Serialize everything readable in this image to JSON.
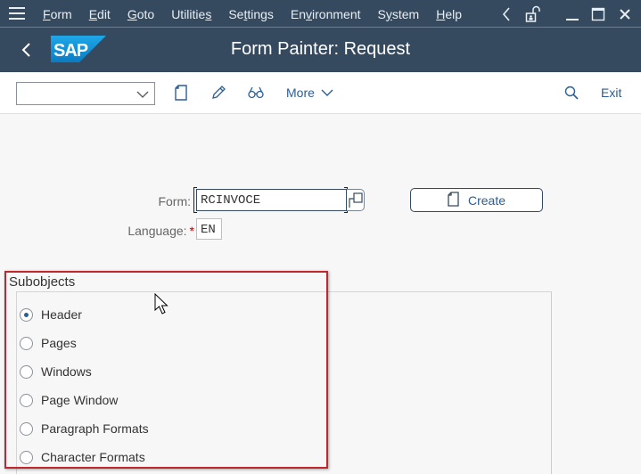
{
  "menubar": {
    "items": [
      {
        "label": "Form",
        "mnemonic": "F"
      },
      {
        "label": "Edit",
        "mnemonic": "E"
      },
      {
        "label": "Goto",
        "mnemonic": "G"
      },
      {
        "label": "Utilities",
        "mnemonic": "s"
      },
      {
        "label": "Settings",
        "mnemonic": "t"
      },
      {
        "label": "Environment",
        "mnemonic": "v"
      },
      {
        "label": "System",
        "mnemonic": "y"
      },
      {
        "label": "Help",
        "mnemonic": "H"
      }
    ],
    "icons": [
      "menu-icon",
      "back-arrow-icon",
      "unlock-icon",
      "minimize-icon",
      "maximize-icon",
      "close-icon"
    ]
  },
  "titlebar": {
    "logo": "SAP",
    "title": "Form Painter: Request"
  },
  "toolbar": {
    "select_value": "",
    "more_label": "More",
    "exit_label": "Exit",
    "icons": [
      "new-document-icon",
      "pencil-icon",
      "glasses-icon",
      "search-icon"
    ]
  },
  "form": {
    "form_label": "Form:",
    "form_value": "RCINVOCE",
    "language_label": "Language:",
    "language_required": "*",
    "language_value": "EN",
    "create_label": "Create"
  },
  "subobjects": {
    "title": "Subobjects",
    "selected": "Header",
    "options": [
      "Header",
      "Pages",
      "Windows",
      "Page Window",
      "Paragraph Formats",
      "Character Formats"
    ]
  },
  "colors": {
    "shell": "#354a5f",
    "accent": "#2a5e94",
    "highlight": "#c0282d",
    "sap_blue": "#0a8fd6"
  }
}
